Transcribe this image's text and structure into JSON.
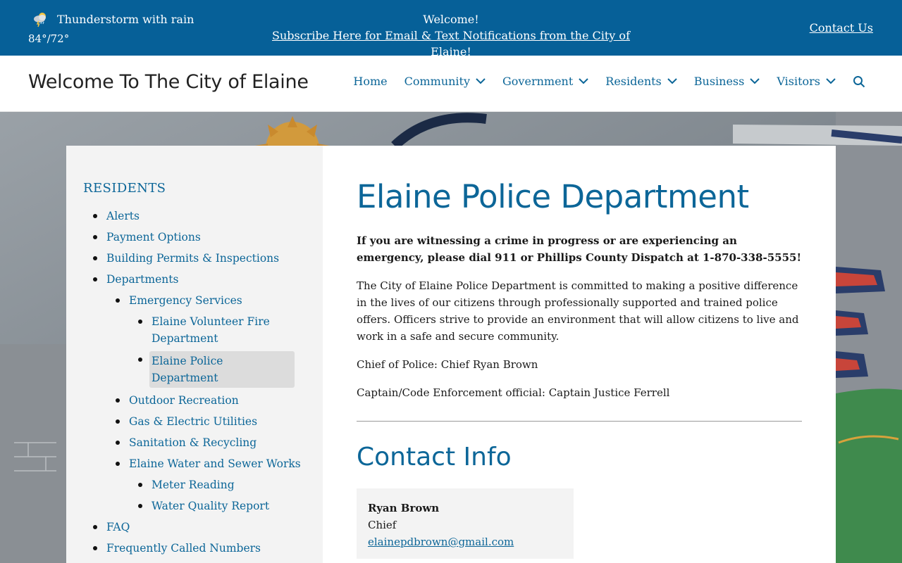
{
  "topbar": {
    "weather": "Thunderstorm with rain",
    "temps": "84°/72°",
    "welcome": "Welcome!",
    "subscribe": "Subscribe Here for Email & Text Notifications from the City of Elaine!",
    "contact_us": "Contact Us"
  },
  "header": {
    "title": "Welcome To The City of Elaine",
    "nav": [
      "Home",
      "Community",
      "Government",
      "Residents",
      "Business",
      "Visitors"
    ]
  },
  "sidebar": {
    "heading": "RESIDENTS",
    "items": [
      "Alerts",
      "Payment Options",
      "Building Permits & Inspections",
      "Departments",
      "Emergency Services",
      "Elaine Volunteer Fire Department",
      "Elaine Police Department",
      "Outdoor Recreation",
      "Gas & Electric Utilities",
      "Sanitation & Recycling",
      "Elaine Water and Sewer Works",
      "Meter Reading",
      "Water Quality Report",
      "FAQ",
      "Frequently Called Numbers"
    ]
  },
  "main": {
    "title": "Elaine Police Department",
    "alert": "If you are witnessing a crime in progress or are experiencing an emergency, please dial 911 or Phillips County Dispatch at 1-870-338-5555!",
    "intro": "The City of Elaine Police Department is committed to making a positive difference in the lives of our citizens through professionally supported and trained police offers. Officers strive to provide an environment that will allow citizens to live and work in a safe and secure community.",
    "chief": "Chief of Police: Chief Ryan Brown",
    "captain": "Captain/Code Enforcement official: Captain Justice Ferrell",
    "contact_heading": "Contact Info",
    "contact": {
      "name": "Ryan Brown",
      "role": "Chief",
      "email": "elainepdbrown@gmail.com"
    }
  },
  "colors": {
    "brand": "#066098",
    "link": "#0c6698"
  }
}
